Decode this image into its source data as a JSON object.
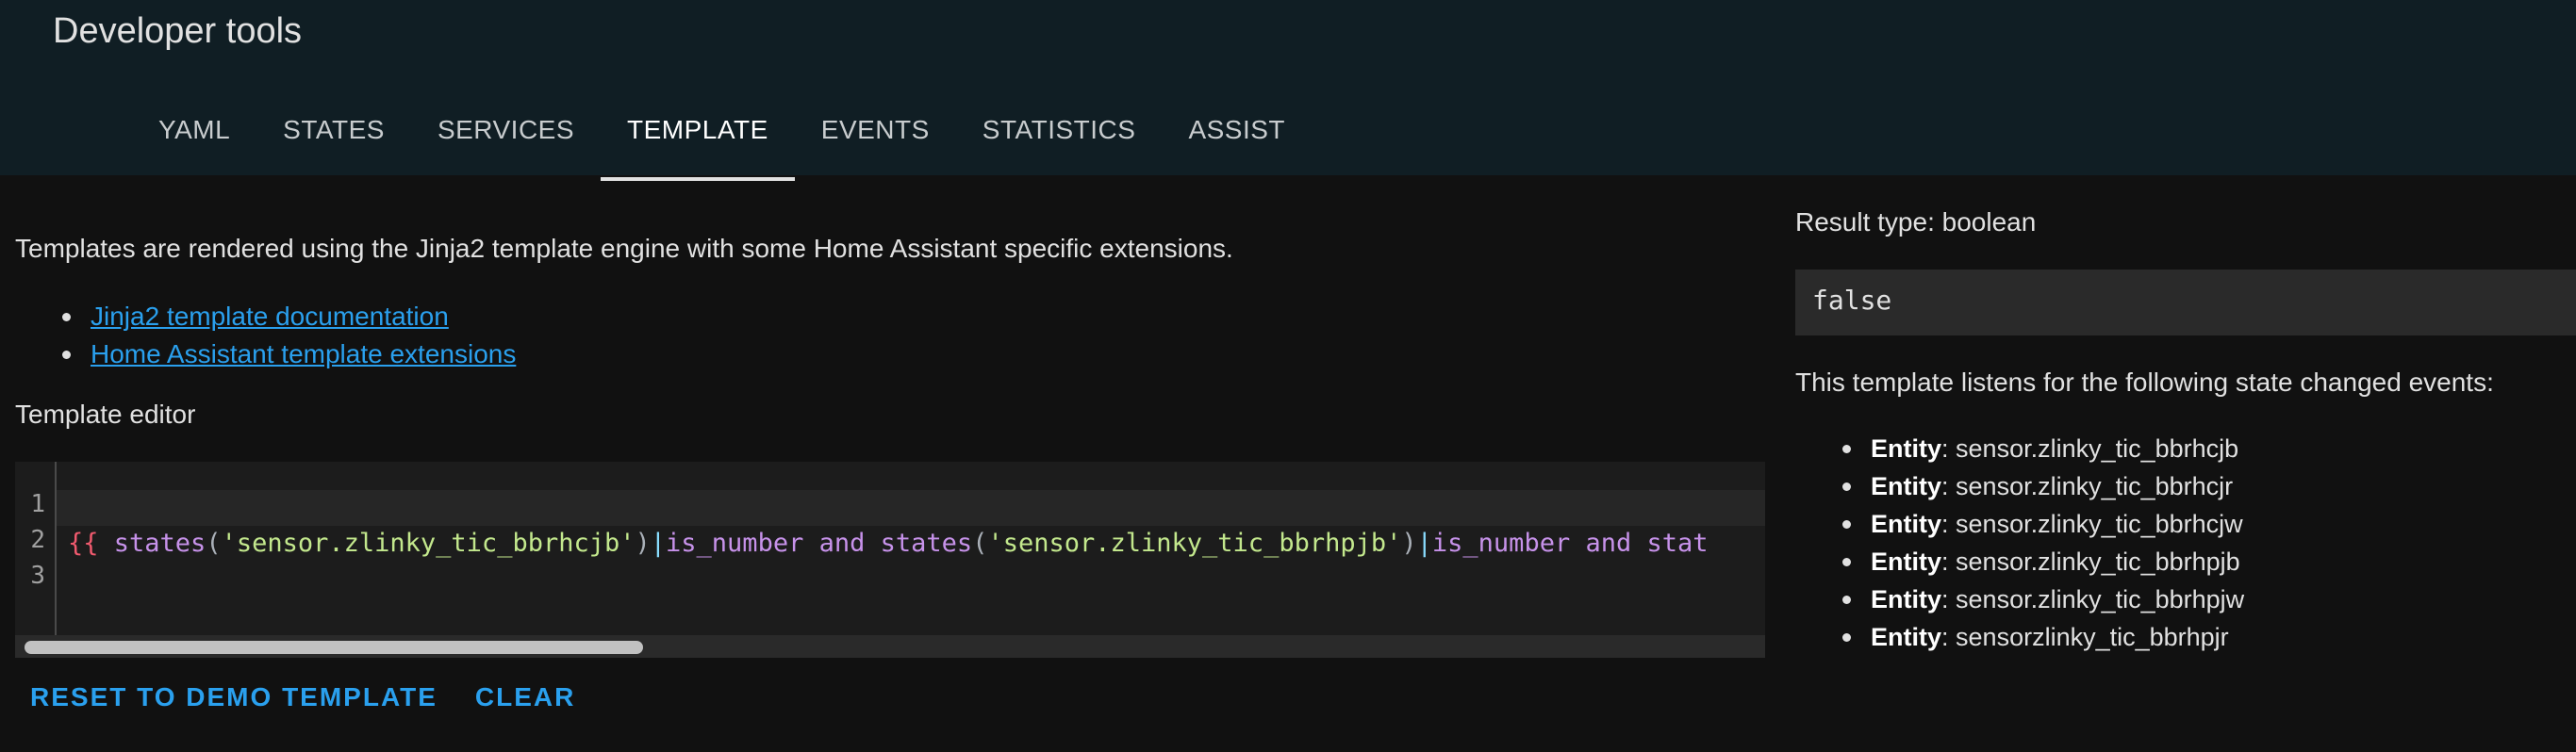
{
  "header": {
    "title": "Developer tools",
    "tabs": [
      {
        "label": "YAML"
      },
      {
        "label": "STATES"
      },
      {
        "label": "SERVICES"
      },
      {
        "label": "TEMPLATE",
        "active": true
      },
      {
        "label": "EVENTS"
      },
      {
        "label": "STATISTICS"
      },
      {
        "label": "ASSIST"
      }
    ]
  },
  "intro": "Templates are rendered using the Jinja2 template engine with some Home Assistant specific extensions.",
  "links": [
    "Jinja2 template documentation",
    "Home Assistant template extensions"
  ],
  "editor": {
    "label": "Template editor",
    "line_numbers": [
      "1",
      "2",
      "3"
    ],
    "code": {
      "open": "{{",
      "fn1": "states",
      "str1": "'sensor.zlinky_tic_bbrhcjb'",
      "pipe": "|",
      "test": "is_number",
      "kw": "and",
      "fn2": "states",
      "str2": "'sensor.zlinky_tic_bbrhpjb'",
      "tail": "stat"
    }
  },
  "actions": {
    "reset_label": "RESET TO DEMO TEMPLATE",
    "clear_label": "CLEAR"
  },
  "result": {
    "type_label": "Result type: boolean",
    "value": "false",
    "listens_text": "This template listens for the following state changed events:",
    "entity_label": "Entity",
    "entities": [
      "sensor.zlinky_tic_bbrhcjb",
      "sensor.zlinky_tic_bbrhcjr",
      "sensor.zlinky_tic_bbrhcjw",
      "sensor.zlinky_tic_bbrhpjb",
      "sensor.zlinky_tic_bbrhpjw",
      "sensorzlinky_tic_bbrhpjr"
    ]
  },
  "colors": {
    "header_bg": "#101e24",
    "page_bg": "#111111",
    "link": "#2aa0ee",
    "code_string": "#c3e88d",
    "code_keyword": "#c792ea",
    "code_brace": "#f05a6e"
  }
}
